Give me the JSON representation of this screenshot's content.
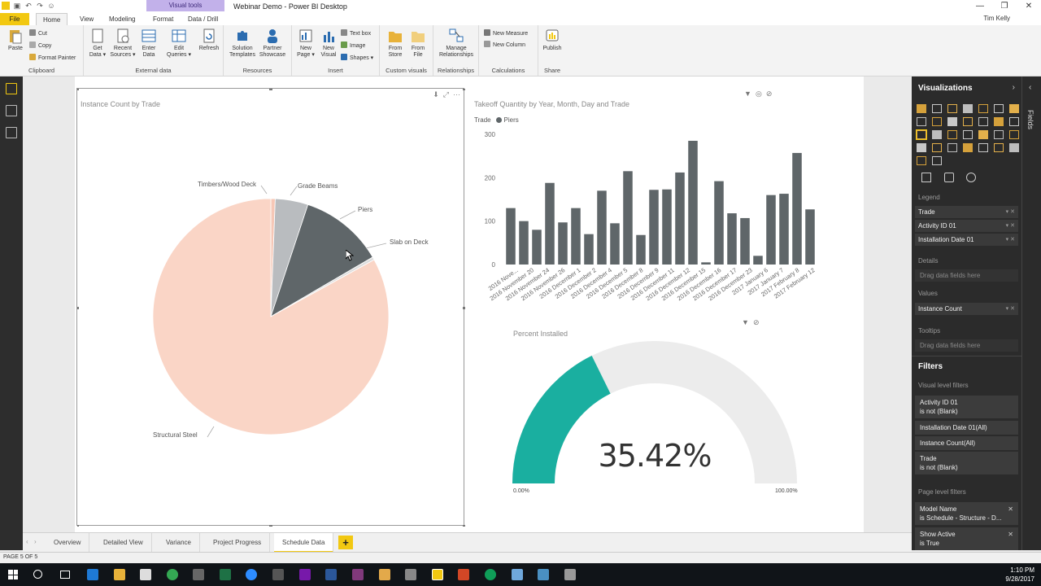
{
  "window": {
    "title": "Webinar Demo - Power BI Desktop",
    "context_group": "Visual tools",
    "controls": [
      "—",
      "❐",
      "✕"
    ]
  },
  "ribbon_tabs": [
    "File",
    "Home",
    "View",
    "Modeling",
    "Format",
    "Data / Drill"
  ],
  "user": "Tim Kelly",
  "ribbon": {
    "clipboard": {
      "paste": "Paste",
      "cut": "Cut",
      "copy": "Copy",
      "format_painter": "Format Painter",
      "label": "Clipboard"
    },
    "external_data": {
      "get_data": [
        "Get",
        "Data ▾"
      ],
      "recent_sources": [
        "Recent",
        "Sources ▾"
      ],
      "enter_data": [
        "Enter",
        "Data"
      ],
      "edit_queries": [
        "Edit",
        "Queries ▾"
      ],
      "refresh": "Refresh",
      "label": "External data"
    },
    "resources": {
      "solution_templates": [
        "Solution",
        "Templates"
      ],
      "partner_showcase": [
        "Partner",
        "Showcase"
      ],
      "label": "Resources"
    },
    "insert": {
      "new_page": [
        "New",
        "Page ▾"
      ],
      "new_visual": [
        "New",
        "Visual"
      ],
      "text_box": "Text box",
      "image": "Image",
      "shapes": "Shapes ▾",
      "label": "Insert"
    },
    "custom_visuals": {
      "from_store": [
        "From",
        "Store"
      ],
      "from_file": [
        "From",
        "File"
      ],
      "label": "Custom visuals"
    },
    "relationships": {
      "manage": [
        "Manage",
        "Relationships"
      ],
      "label": "Relationships"
    },
    "calculations": {
      "new_measure": "New Measure",
      "new_column": "New Column",
      "label": "Calculations"
    },
    "share": {
      "publish": "Publish",
      "label": "Share"
    }
  },
  "pie_visual": {
    "title": "Instance Count by Trade",
    "labels": [
      "Timbers/Wood Deck",
      "Grade Beams",
      "Piers",
      "Slab on Deck",
      "Structural Steel"
    ]
  },
  "bar_visual": {
    "title": "Takeoff Quantity by Year, Month, Day and Trade",
    "legend_title": "Trade",
    "legend_item": "Piers"
  },
  "gauge_visual": {
    "title": "Percent Installed",
    "value_label": "35.42%",
    "min_label": "0.00%",
    "max_label": "100.00%",
    "value": 0.3542
  },
  "chart_data": [
    {
      "type": "pie",
      "title": "Instance Count by Trade",
      "slices": [
        {
          "name": "Timbers/Wood Deck",
          "value": 0.6,
          "color": "#f6c7b6"
        },
        {
          "name": "Grade Beams",
          "value": 4.5,
          "color": "#b9bcbf"
        },
        {
          "name": "Piers",
          "value": 11.5,
          "color": "#5f6669"
        },
        {
          "name": "Slab on Deck",
          "value": 0.4,
          "color": "#dddddd"
        },
        {
          "name": "Structural Steel",
          "value": 83.0,
          "color": "#fad5c6"
        }
      ]
    },
    {
      "type": "bar",
      "title": "Takeoff Quantity by Year, Month, Day and Trade",
      "series": [
        {
          "name": "Piers",
          "color": "#5f6669"
        }
      ],
      "categories": [
        "2016 Nove...",
        "2016 November 20",
        "2016 November 24",
        "2016 November 26",
        "2016 December 1",
        "2016 December 2",
        "2016 December 4",
        "2016 December 5",
        "2016 December 8",
        "2016 December 9",
        "2016 December 11",
        "2016 December 12",
        "2016 December 15",
        "2016 December 16",
        "2016 December 17",
        "2016 December 23",
        "2017 January 6",
        "2017 January 7",
        "2017 February 8",
        "2017 February 12"
      ],
      "values": [
        130,
        100,
        80,
        188,
        97,
        130,
        70,
        170,
        95,
        215,
        68,
        172,
        173,
        212,
        285,
        5,
        192,
        118,
        107,
        20,
        160,
        163,
        257,
        127
      ],
      "ylim": [
        0,
        300
      ],
      "yticks": [
        "0",
        "100",
        "200",
        "300"
      ]
    },
    {
      "type": "gauge",
      "title": "Percent Installed",
      "value": 35.42,
      "min": 0,
      "max": 100,
      "fill_color": "#1aafa0",
      "track_color": "#ececec"
    }
  ],
  "visualizations_pane": {
    "title": "Visualizations",
    "fields_tab": "Fields",
    "legend_label": "Legend",
    "legend_fields": [
      "Trade",
      "Activity ID 01",
      "Installation Date 01"
    ],
    "details_label": "Details",
    "details_drop": "Drag data fields here",
    "values_label": "Values",
    "values_field": "Instance Count",
    "tooltips_label": "Tooltips",
    "tooltips_drop": "Drag data fields here"
  },
  "filters_pane": {
    "title": "Filters",
    "visual_level_label": "Visual level filters",
    "visual_filters": [
      [
        "Activity ID 01",
        "is not (Blank)"
      ],
      [
        "Installation Date 01(All)"
      ],
      [
        "Instance Count(All)"
      ],
      [
        "Trade",
        "is not (Blank)"
      ]
    ],
    "page_level_label": "Page level filters",
    "page_filters": [
      [
        "Model Name",
        "is Schedule - Structure - D..."
      ],
      [
        "Show Active",
        "is True"
      ]
    ]
  },
  "page_tabs": [
    "Overview",
    "Detailed View",
    "Variance",
    "Project Progress",
    "Schedule Data"
  ],
  "active_page": "Schedule Data",
  "status": {
    "page_indicator": "PAGE 5 OF 5"
  },
  "taskbar": {
    "time": "1:10 PM",
    "date": "9/28/2017"
  }
}
